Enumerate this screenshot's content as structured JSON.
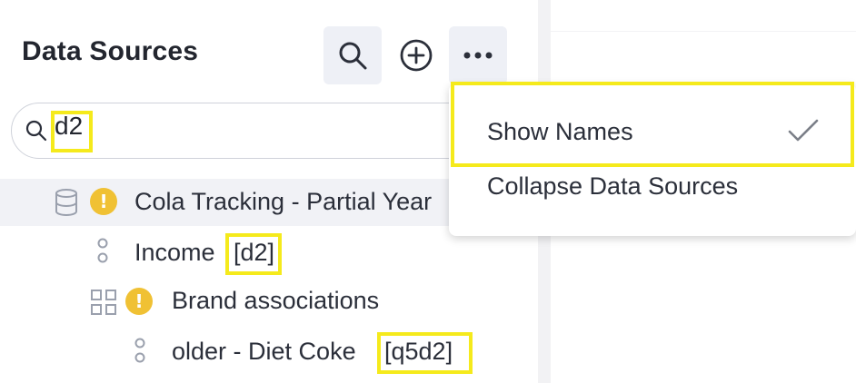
{
  "panel": {
    "title": "Data Sources",
    "toolbar": {
      "search_icon": "search-icon",
      "add_icon": "plus-circle-icon",
      "more_icon": "more-horizontal-icon"
    },
    "search": {
      "value": "d2"
    }
  },
  "tree": [
    {
      "label": "Cola Tracking - Partial Year",
      "icon": "database-icon",
      "warning": true,
      "selected": true
    },
    {
      "label": "Income",
      "tag": "[d2]",
      "icon": "variable-icon"
    },
    {
      "label": "Brand associations",
      "icon": "grid-icon",
      "warning": true
    },
    {
      "label": "older - Diet Coke",
      "tag": "[q5d2]",
      "icon": "variable-icon"
    }
  ],
  "menu": {
    "items": [
      {
        "label": "Show Names",
        "checked": true
      },
      {
        "label": "Collapse Data Sources",
        "checked": false
      }
    ]
  },
  "colors": {
    "highlight": "#f5ea1c",
    "warning": "#f0c134",
    "selected_row": "#f1f2f6"
  }
}
